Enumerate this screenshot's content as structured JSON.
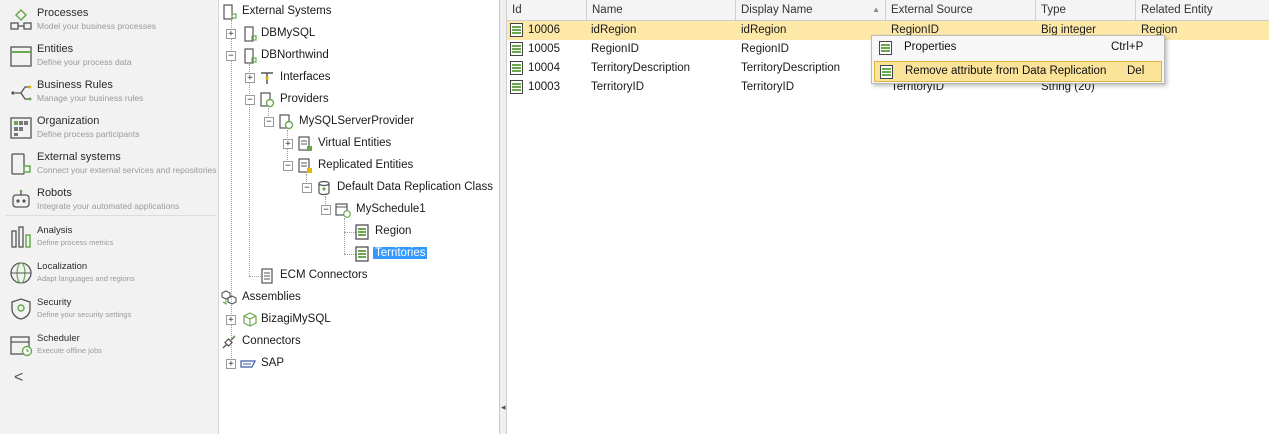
{
  "nav": {
    "items": [
      {
        "title": "Processes",
        "subtitle": "Model your business processes",
        "icon": "processes-icon"
      },
      {
        "title": "Entities",
        "subtitle": "Define your process data",
        "icon": "entities-icon"
      },
      {
        "title": "Business Rules",
        "subtitle": "Manage your business rules",
        "icon": "business-rules-icon"
      },
      {
        "title": "Organization",
        "subtitle": "Define process participants",
        "icon": "organization-icon"
      },
      {
        "title": "External systems",
        "subtitle": "Connect your external services and repositories",
        "icon": "external-systems-icon"
      },
      {
        "title": "Robots",
        "subtitle": "Integrate your automated applications",
        "icon": "robots-icon"
      },
      {
        "title": "Analysis",
        "subtitle": "Define process metrics",
        "icon": "analysis-icon"
      },
      {
        "title": "Localization",
        "subtitle": "Adapt languages and regions",
        "icon": "localization-icon"
      },
      {
        "title": "Security",
        "subtitle": "Define your security settings",
        "icon": "security-icon"
      },
      {
        "title": "Scheduler",
        "subtitle": "Execute offline jobs",
        "icon": "scheduler-icon"
      }
    ],
    "collapse_glyph": "<"
  },
  "tree": {
    "nodes": [
      {
        "label": "External Systems",
        "expander": "",
        "icon": "external-systems-node-icon"
      },
      {
        "label": "DBMySQL",
        "expander": "+",
        "icon": "database-system-icon"
      },
      {
        "label": "DBNorthwind",
        "expander": "−",
        "icon": "database-system-icon"
      },
      {
        "label": "Interfaces",
        "expander": "+",
        "icon": "interfaces-icon"
      },
      {
        "label": "Providers",
        "expander": "−",
        "icon": "providers-icon"
      },
      {
        "label": "MySQLServerProvider",
        "expander": "−",
        "icon": "provider-icon"
      },
      {
        "label": "Virtual Entities",
        "expander": "+",
        "icon": "virtual-entities-icon"
      },
      {
        "label": "Replicated Entities",
        "expander": "−",
        "icon": "replicated-entities-icon"
      },
      {
        "label": "Default Data Replication Class",
        "expander": "−",
        "icon": "replication-class-icon"
      },
      {
        "label": "MySchedule1",
        "expander": "−",
        "icon": "schedule-icon"
      },
      {
        "label": "Region",
        "expander": "",
        "icon": "entity-table-icon"
      },
      {
        "label": "Territories",
        "expander": "",
        "icon": "entity-table-icon"
      },
      {
        "label": "ECM Connectors",
        "expander": "",
        "icon": "ecm-connectors-icon"
      },
      {
        "label": "Assemblies",
        "expander": "",
        "icon": "assemblies-icon"
      },
      {
        "label": "BizagiMySQL",
        "expander": "+",
        "icon": "assembly-icon"
      },
      {
        "label": "Connectors",
        "expander": "",
        "icon": "connectors-icon"
      },
      {
        "label": "SAP",
        "expander": "+",
        "icon": "sap-icon"
      }
    ],
    "selected": "Territories"
  },
  "splitter": {
    "arrow": "◂"
  },
  "grid": {
    "columns": [
      "Id",
      "Name",
      "Display Name",
      "External Source",
      "Type",
      "Related Entity"
    ],
    "sort_indicator": "▲",
    "rows": [
      {
        "id": "10006",
        "name": "idRegion",
        "display": "idRegion",
        "source": "RegionID",
        "type": "Big integer",
        "related": "Region"
      },
      {
        "id": "10005",
        "name": "RegionID",
        "display": "RegionID",
        "source": "",
        "type": "",
        "related": ""
      },
      {
        "id": "10004",
        "name": "TerritoryDescription",
        "display": "TerritoryDescription",
        "source": "",
        "type": "",
        "related": ""
      },
      {
        "id": "10003",
        "name": "TerritoryID",
        "display": "TerritoryID",
        "source": "TerritoryID",
        "type": "String (20)",
        "related": ""
      }
    ]
  },
  "context_menu": {
    "items": [
      {
        "label": "Properties",
        "shortcut": "Ctrl+P"
      },
      {
        "label": "Remove attribute from Data Replication",
        "shortcut": "Del"
      }
    ]
  },
  "colors": {
    "selection_blue": "#3399ff",
    "row_highlight": "#fde8a8",
    "menu_hover": "#fbe39a",
    "icon_green": "#6aa84f",
    "icon_yellow": "#e8b400"
  }
}
